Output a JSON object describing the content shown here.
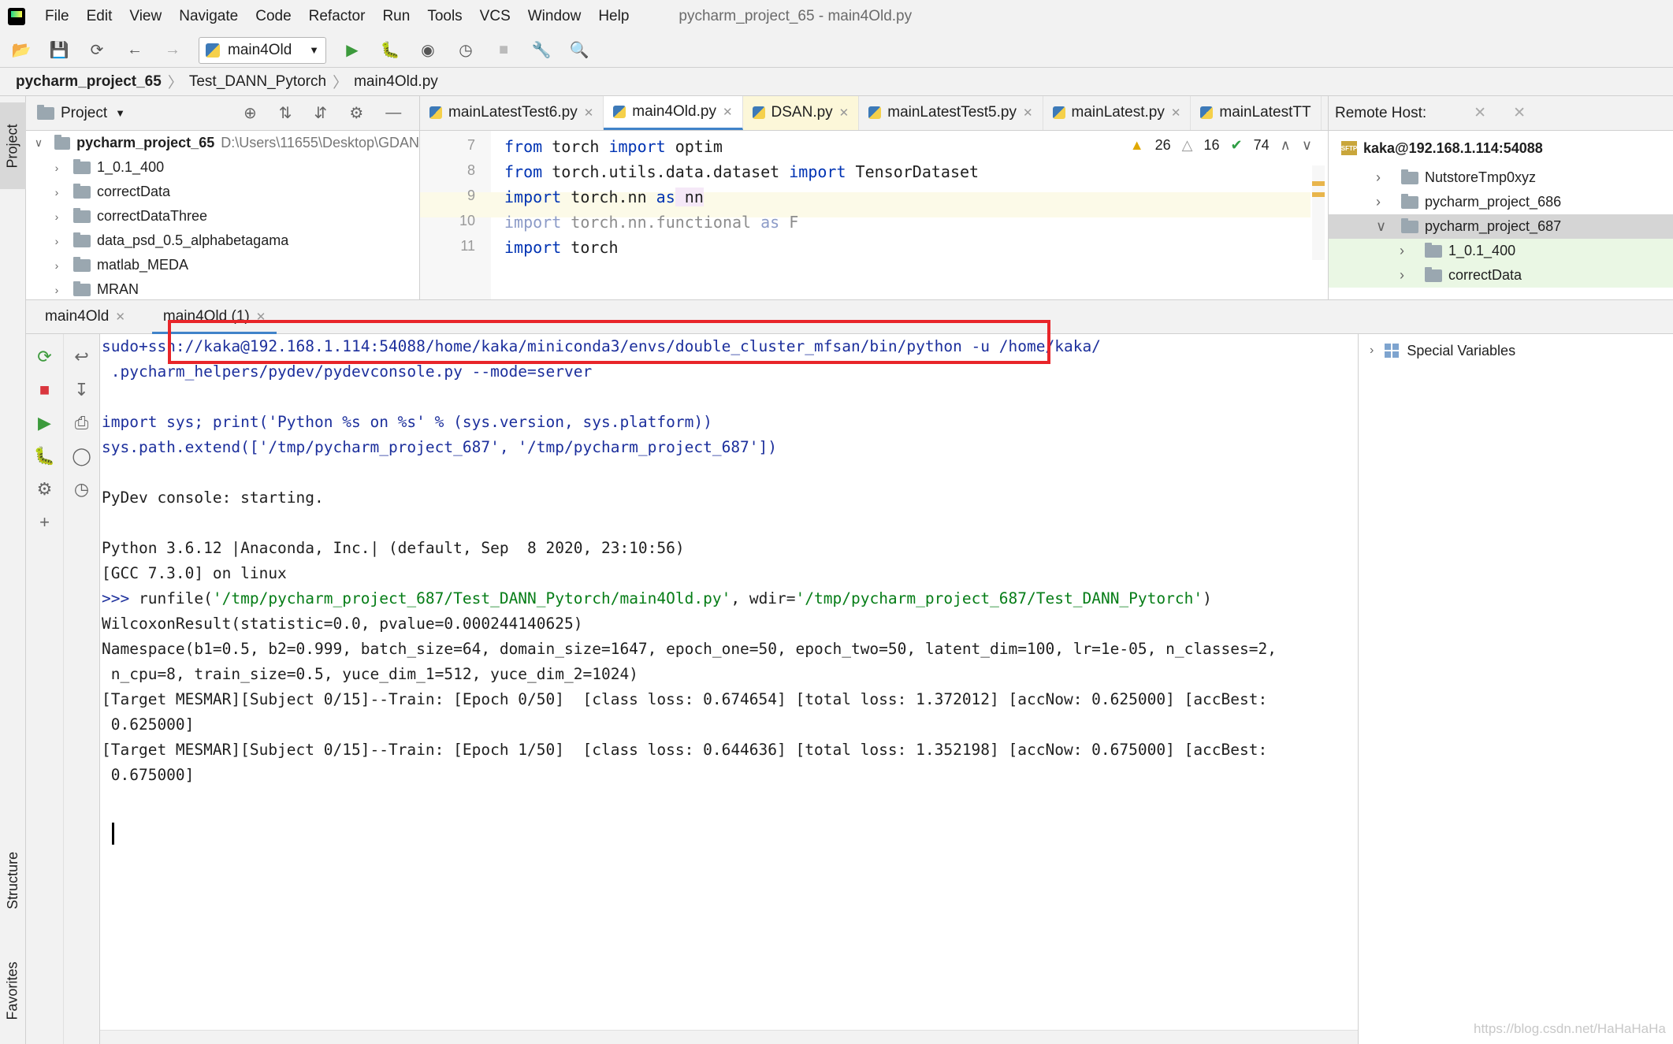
{
  "menubar": {
    "items": [
      "File",
      "Edit",
      "View",
      "Navigate",
      "Code",
      "Refactor",
      "Run",
      "Tools",
      "VCS",
      "Window",
      "Help"
    ],
    "window_title": "pycharm_project_65 - main4Old.py"
  },
  "toolbar": {
    "run_config": "main4Old"
  },
  "breadcrumb": {
    "project": "pycharm_project_65",
    "folder": "Test_DANN_Pytorch",
    "file": "main4Old.py"
  },
  "sidebar": {
    "project_tab": "Project",
    "structure_tab": "Structure",
    "favorites_tab": "Favorites"
  },
  "project_panel": {
    "title": "Project",
    "root": "pycharm_project_65",
    "root_path": "D:\\Users\\11655\\Desktop\\GDAN",
    "items": [
      "1_0.1_400",
      "correctData",
      "correctDataThree",
      "data_psd_0.5_alphabetagama",
      "matlab_MEDA",
      "MRAN"
    ]
  },
  "editor": {
    "tabs": [
      "mainLatestTest6.py",
      "main4Old.py",
      "DSAN.py",
      "mainLatestTest5.py",
      "mainLatest.py",
      "mainLatestTT"
    ],
    "inspections": {
      "warnings": "26",
      "weak_warnings": "16",
      "ok": "74"
    },
    "lines": [
      {
        "num": "7",
        "kw1": "from",
        "t1": " torch ",
        "kw2": "import",
        "t2": " optim"
      },
      {
        "num": "8",
        "kw1": "from",
        "t1": " torch.utils.data.dataset ",
        "kw2": "import",
        "t2": " TensorDataset"
      },
      {
        "num": "9",
        "kw1": "import",
        "t1": " torch.nn ",
        "kw2": "as",
        "t2": " nn"
      },
      {
        "num": "10",
        "kw1": "import",
        "t1": " torch.nn.functional ",
        "kw2": "as",
        "t2": " F"
      },
      {
        "num": "11",
        "kw1": "import",
        "t1": " torch",
        "kw2": "",
        "t2": ""
      }
    ]
  },
  "remote_panel": {
    "title": "Remote Host:",
    "host": "kaka@192.168.1.114:54088",
    "items": [
      "NutstoreTmp0xyz",
      "pycharm_project_686",
      "pycharm_project_687",
      "1_0.1_400",
      "correctData"
    ]
  },
  "run_window": {
    "tabs": [
      "main4Old",
      "main4Old (1)"
    ],
    "console": {
      "l1": "sudo+ssh://kaka@192.168.1.114:54088/home/kaka/miniconda3/envs/double_cluster_mfsan/bin/python -u /home/kaka/",
      "l2": " .pycharm_helpers/pydev/pydevconsole.py --mode=server",
      "l3": "import sys; print('Python %s on %s' % (sys.version, sys.platform))",
      "l4": "sys.path.extend(['/tmp/pycharm_project_687', '/tmp/pycharm_project_687'])",
      "l5": "PyDev console: starting.",
      "l6": "Python 3.6.12 |Anaconda, Inc.| (default, Sep  8 2020, 23:10:56)",
      "l7": "[GCC 7.3.0] on linux",
      "l8_prompt": ">>> ",
      "l8_fn": "runfile(",
      "l8_arg1": "'/tmp/pycharm_project_687/Test_DANN_Pytorch/main4Old.py'",
      "l8_mid": ", wdir=",
      "l8_arg2": "'/tmp/pycharm_project_687/Test_DANN_Pytorch'",
      "l8_end": ")",
      "l9": "WilcoxonResult(statistic=0.0, pvalue=0.000244140625)",
      "l10": "Namespace(b1=0.5, b2=0.999, batch_size=64, domain_size=1647, epoch_one=50, epoch_two=50, latent_dim=100, lr=1e-05, n_classes=2,",
      "l11": " n_cpu=8, train_size=0.5, yuce_dim_1=512, yuce_dim_2=1024)",
      "l12": "[Target MESMAR][Subject 0/15]--Train: [Epoch 0/50]  [class loss: 0.674654] [total loss: 1.372012] [accNow: 0.625000] [accBest:",
      "l13": " 0.625000]",
      "l14": "[Target MESMAR][Subject 0/15]--Train: [Epoch 1/50]  [class loss: 0.644636] [total loss: 1.352198] [accNow: 0.675000] [accBest:",
      "l15": " 0.675000]"
    },
    "variables": "Special Variables"
  },
  "watermark": "https://blog.csdn.net/HaHaHaHa"
}
